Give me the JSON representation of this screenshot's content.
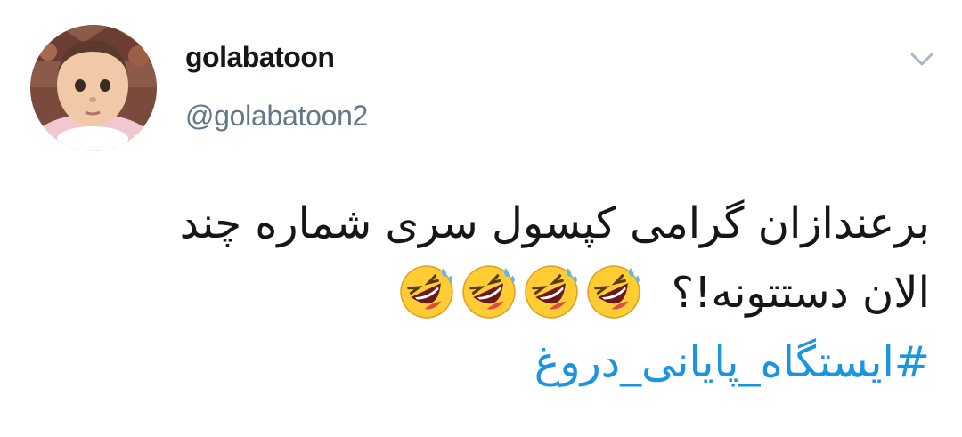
{
  "user": {
    "display_name": "golabatoon",
    "handle": "@golabatoon2",
    "avatar_icon": "baby-photo-avatar"
  },
  "menu": {
    "caret_icon": "chevron-down-icon"
  },
  "tweet": {
    "line1": "برعندازان گرامی کپسول سری شماره چند",
    "line2_text": "الان دستتونه!؟",
    "line2_emojis": [
      "rolling-on-floor-laughing-emoji",
      "rolling-on-floor-laughing-emoji",
      "rolling-on-floor-laughing-emoji",
      "rolling-on-floor-laughing-emoji"
    ],
    "hashtag": "#ایستگاه_پایانی_دروغ"
  },
  "colors": {
    "text": "#14171a",
    "secondary": "#657786",
    "link": "#1b95e0",
    "caret": "#aab8c2"
  }
}
